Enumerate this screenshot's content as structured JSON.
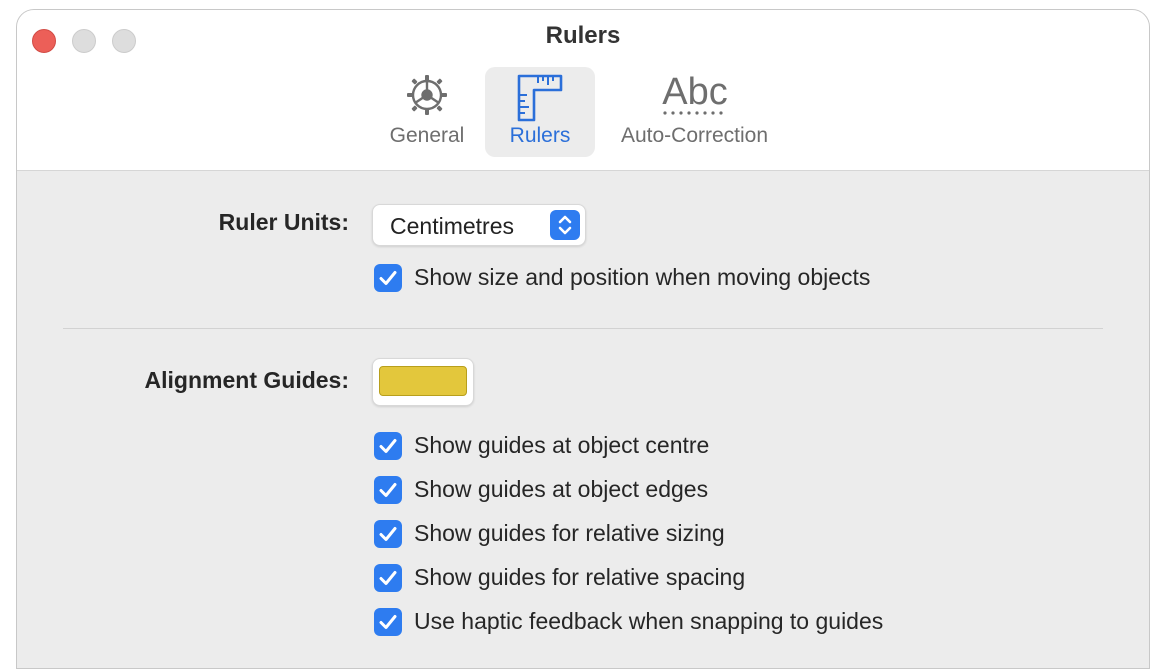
{
  "window": {
    "title": "Rulers"
  },
  "tabs": [
    {
      "label": "General",
      "icon": "gear-icon",
      "active": false
    },
    {
      "label": "Rulers",
      "icon": "ruler-icon",
      "active": true
    },
    {
      "label": "Auto-Correction",
      "icon": "abc-icon",
      "active": false
    }
  ],
  "tab_icon_text": {
    "auto_correction": "Abc"
  },
  "ruler_units": {
    "label": "Ruler Units:",
    "selected": "Centimetres"
  },
  "show_size_position": {
    "label": "Show size and position when moving objects",
    "checked": true
  },
  "alignment_guides": {
    "label": "Alignment Guides:",
    "color": "#e3c73c",
    "options": [
      {
        "label": "Show guides at object centre",
        "checked": true
      },
      {
        "label": "Show guides at object edges",
        "checked": true
      },
      {
        "label": "Show guides for relative sizing",
        "checked": true
      },
      {
        "label": "Show guides for relative spacing",
        "checked": true
      },
      {
        "label": "Use haptic feedback when snapping to guides",
        "checked": true
      }
    ]
  },
  "colors": {
    "accent": "#2e7cf0",
    "active_tab_text": "#2b6fd9",
    "close_button": "#ec5f58"
  }
}
